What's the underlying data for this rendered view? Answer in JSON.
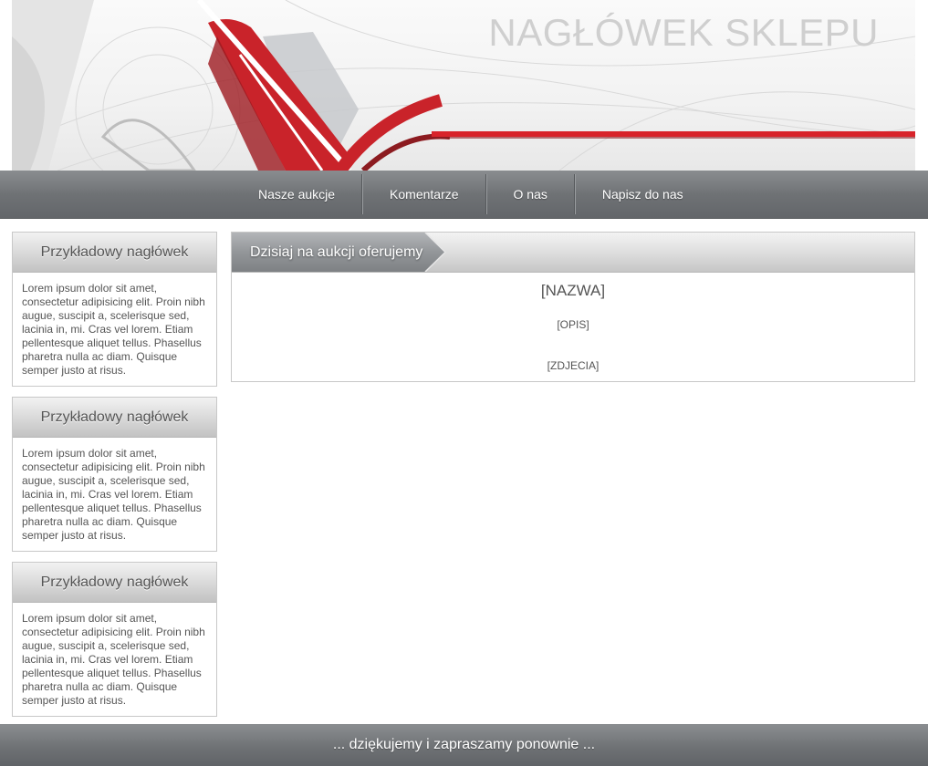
{
  "header": {
    "shop_title": "NAGŁÓWEK SKLEPU"
  },
  "nav": {
    "items": [
      {
        "label": "Nasze aukcje"
      },
      {
        "label": "Komentarze"
      },
      {
        "label": "O nas"
      },
      {
        "label": "Napisz do nas"
      }
    ]
  },
  "sidebar": {
    "boxes": [
      {
        "heading": "Przykładowy nagłówek",
        "text": "Lorem ipsum dolor sit amet, consectetur adipisicing elit. Proin nibh augue, suscipit a, scelerisque sed, lacinia in, mi. Cras vel lorem. Etiam pellentesque aliquet tellus. Phasellus pharetra nulla ac diam. Quisque semper justo at risus."
      },
      {
        "heading": "Przykładowy nagłówek",
        "text": "Lorem ipsum dolor sit amet, consectetur adipisicing elit. Proin nibh augue, suscipit a, scelerisque sed, lacinia in, mi. Cras vel lorem. Etiam pellentesque aliquet tellus. Phasellus pharetra nulla ac diam. Quisque semper justo at risus."
      },
      {
        "heading": "Przykładowy nagłówek",
        "text": "Lorem ipsum dolor sit amet, consectetur adipisicing elit. Proin nibh augue, suscipit a, scelerisque sed, lacinia in, mi. Cras vel lorem. Etiam pellentesque aliquet tellus. Phasellus pharetra nulla ac diam. Quisque semper justo at risus."
      }
    ]
  },
  "main": {
    "tab_label": "Dzisiaj na aukcji oferujemy",
    "item_name": "[NAZWA]",
    "item_description": "[OPIS]",
    "item_photos": "[ZDJECIA]"
  },
  "footer": {
    "text": "... dziękujemy i zapraszamy ponownie ..."
  },
  "colors": {
    "accent_red": "#d8232a",
    "nav_gray": "#6f7275",
    "text_gray": "#555555"
  }
}
